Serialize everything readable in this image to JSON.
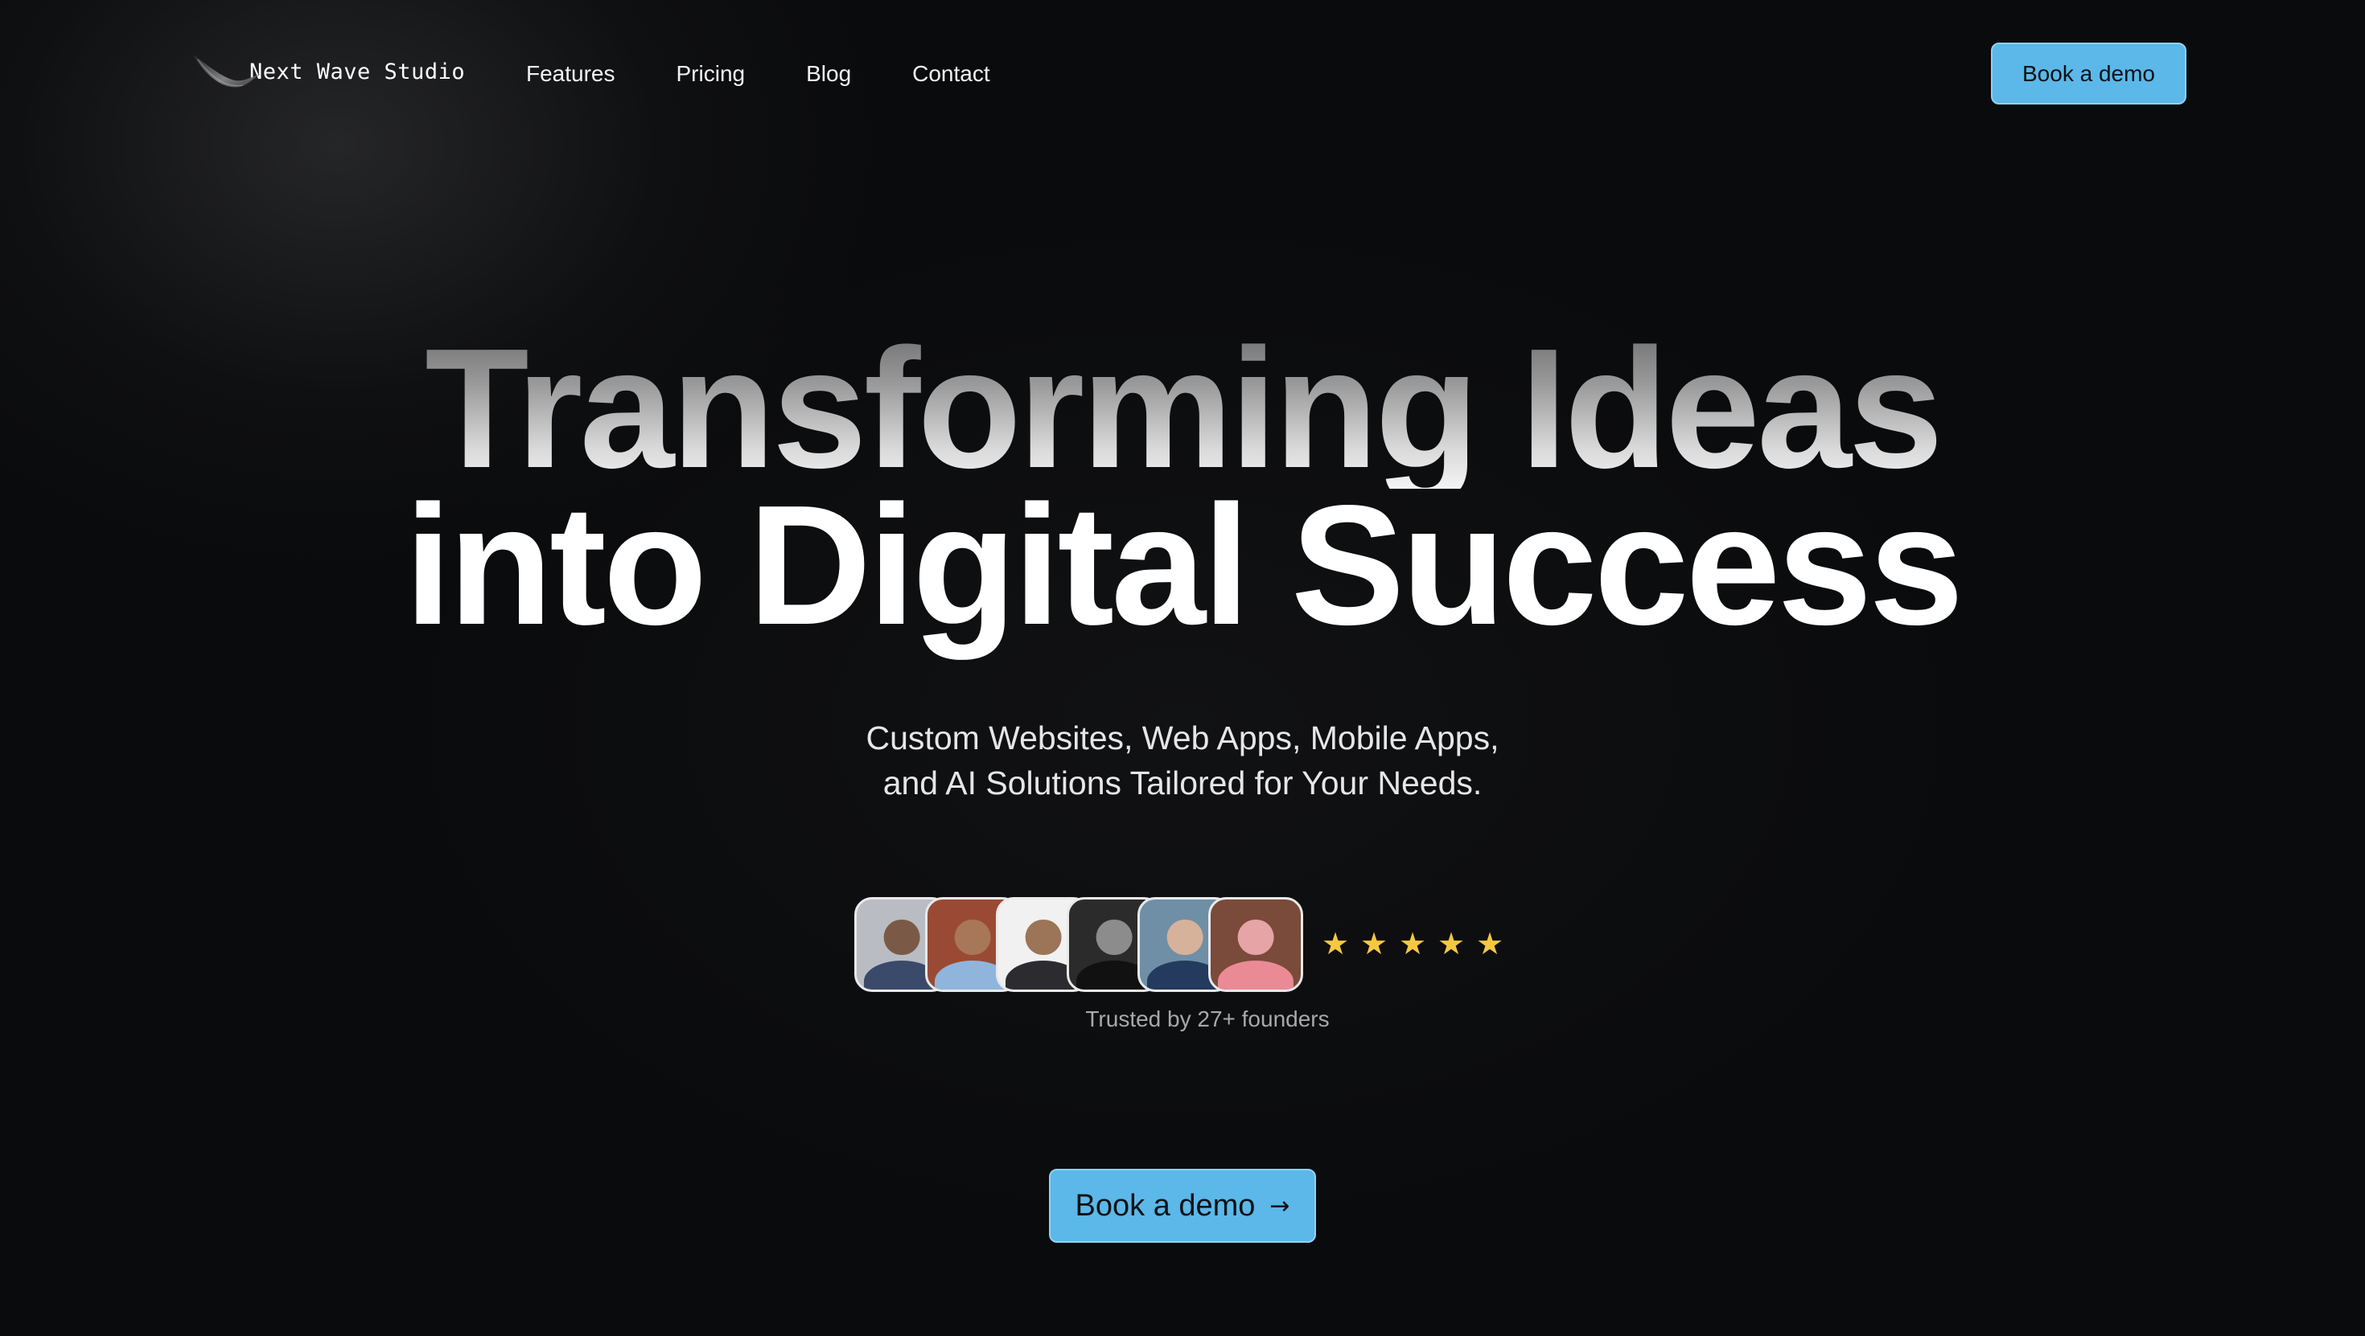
{
  "brand": {
    "name": "Next Wave Studio",
    "logo_icon": "wave-swoosh-icon"
  },
  "nav": {
    "links": [
      "Features",
      "Pricing",
      "Blog",
      "Contact"
    ],
    "cta_label": "Book a demo"
  },
  "hero": {
    "title_line1": "Transforming Ideas",
    "title_line2": "into Digital Success",
    "subtitle_line1": "Custom Websites, Web Apps, Mobile Apps,",
    "subtitle_line2": "and AI Solutions Tailored for Your Needs.",
    "rating_stars": 5,
    "trusted_text": "Trusted by 27+ founders",
    "cta_label": "Book a demo",
    "cta_icon": "arrow-right-icon"
  },
  "colors": {
    "background": "#0a0b0d",
    "accent": "#5bb8e8",
    "star": "#f5c842"
  }
}
